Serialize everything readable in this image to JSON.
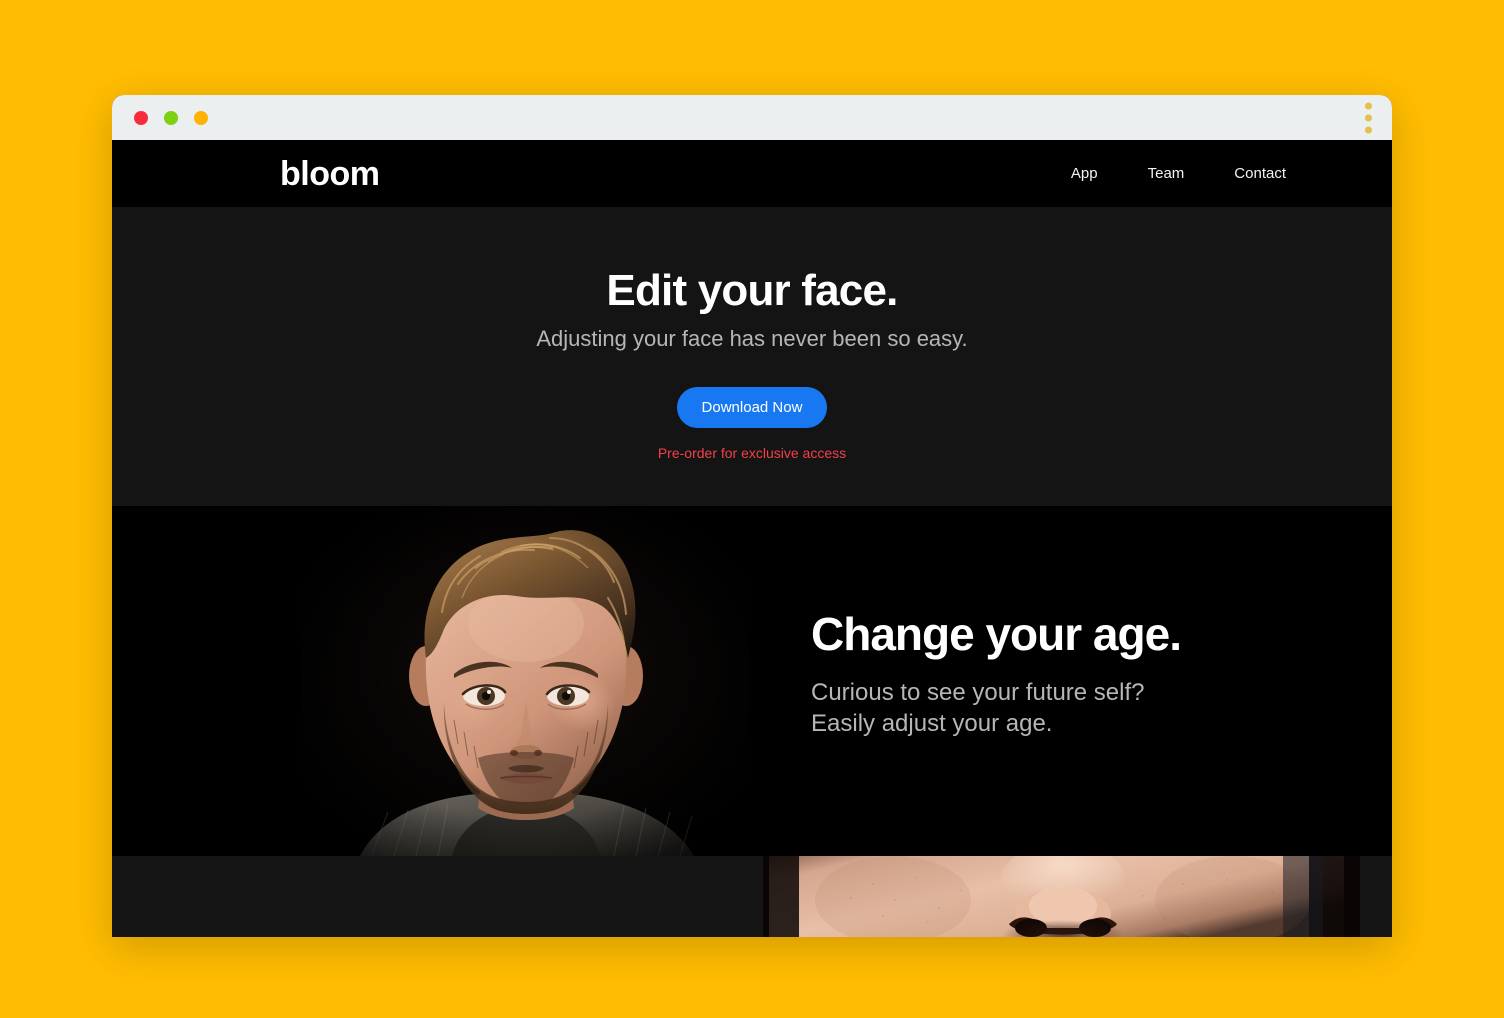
{
  "page": {
    "background_color": "#FFBC02"
  },
  "window": {
    "titlebar": {
      "background_color": "#eceff0",
      "traffic_lights": [
        {
          "name": "close",
          "color": "#fa2b3c"
        },
        {
          "name": "minimize",
          "color": "#7ed111"
        },
        {
          "name": "maximize",
          "color": "#ffb300"
        }
      ],
      "menu_icon": "kebab-menu-icon",
      "menu_dot_color": "#e3c04a"
    }
  },
  "header": {
    "brand": "bloom",
    "background_color": "#000000",
    "nav": [
      {
        "label": "App"
      },
      {
        "label": "Team"
      },
      {
        "label": "Contact"
      }
    ]
  },
  "hero": {
    "background_color": "#141414",
    "title": "Edit your face.",
    "subtitle": "Adjusting your face has never been so easy.",
    "cta_label": "Download Now",
    "cta_color": "#1778f2",
    "preorder_label": "Pre-order for exclusive access",
    "preorder_color": "#f3404a"
  },
  "feature": {
    "background_color": "#000000",
    "title": "Change your age.",
    "text": "Curious to see your future self?\nEasily adjust your age.",
    "image_alt": "portrait-of-young-man-with-beard-on-black-background"
  },
  "bottom": {
    "background_color": "#141414",
    "image_alt": "closeup-of-nose-and-cheeks"
  }
}
